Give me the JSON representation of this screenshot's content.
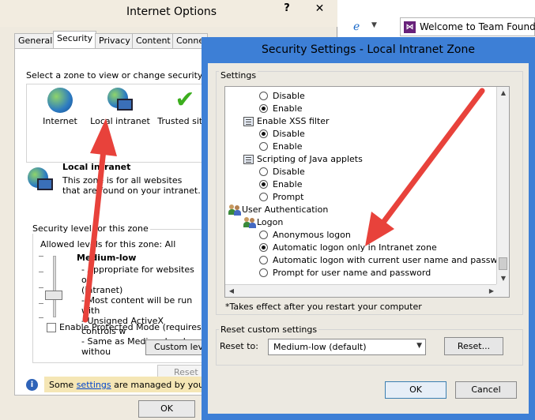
{
  "internet_options": {
    "title": "Internet Options",
    "help": "?",
    "close": "✕",
    "tabs": [
      "General",
      "Security",
      "Privacy",
      "Content",
      "Conne"
    ],
    "zone_prompt": "Select a zone to view or change security setti",
    "zones": [
      {
        "label": "Internet",
        "icon": "globe-icon"
      },
      {
        "label": "Local intranet",
        "icon": "intranet-icon"
      },
      {
        "label": "Trusted sites",
        "icon": "checkmark-icon"
      }
    ],
    "zone_name": "Local intranet",
    "zone_desc": "This zone is for all websites that are found on your intranet.",
    "security_level_legend": "Security level for this zone",
    "allowed_levels": "Allowed levels for this zone: All",
    "level_name": "Medium-low",
    "level_desc_lines": [
      "- Appropriate for websites on",
      "(intranet)",
      "- Most content will be run with",
      "- Unsigned ActiveX controls w",
      "- Same as Medium level withou"
    ],
    "protected_mode_label": "Enable Protected Mode (requires rest",
    "custom_level_button": "Custom level",
    "reset_button": "Reset",
    "info_prefix": "Some ",
    "info_link": "settings",
    "info_suffix": " are managed by your sy",
    "ok_button": "OK"
  },
  "browser": {
    "tab_title": "Welcome to Team Foundat",
    "tab_icon": "visual-studio-icon"
  },
  "security_settings": {
    "title": "Security Settings - Local Intranet Zone",
    "settings_legend": "Settings",
    "tree": [
      {
        "kind": "radio",
        "label": "Disable",
        "selected": false,
        "indent": 1
      },
      {
        "kind": "radio",
        "label": "Enable",
        "selected": true,
        "indent": 1
      },
      {
        "kind": "category",
        "label": "Enable XSS filter",
        "indent": 0
      },
      {
        "kind": "radio",
        "label": "Disable",
        "selected": true,
        "indent": 1
      },
      {
        "kind": "radio",
        "label": "Enable",
        "selected": false,
        "indent": 1
      },
      {
        "kind": "category",
        "label": "Scripting of Java applets",
        "indent": 0
      },
      {
        "kind": "radio",
        "label": "Disable",
        "selected": false,
        "indent": 1
      },
      {
        "kind": "radio",
        "label": "Enable",
        "selected": true,
        "indent": 1
      },
      {
        "kind": "radio",
        "label": "Prompt",
        "selected": false,
        "indent": 1
      },
      {
        "kind": "group",
        "label": "User Authentication",
        "indent": -1
      },
      {
        "kind": "group",
        "label": "Logon",
        "indent": 0
      },
      {
        "kind": "radio",
        "label": "Anonymous logon",
        "selected": false,
        "indent": 1
      },
      {
        "kind": "radio",
        "label": "Automatic logon only in Intranet zone",
        "selected": true,
        "indent": 1
      },
      {
        "kind": "radio",
        "label": "Automatic logon with current user name and password",
        "selected": false,
        "indent": 1
      },
      {
        "kind": "radio",
        "label": "Prompt for user name and password",
        "selected": false,
        "indent": 1
      }
    ],
    "takes_effect": "*Takes effect after you restart your computer",
    "reset_legend": "Reset custom settings",
    "reset_to_label": "Reset to:",
    "reset_to_value": "Medium-low (default)",
    "reset_button": "Reset...",
    "ok_button": "OK",
    "cancel_button": "Cancel"
  },
  "colors": {
    "title_bar_active": "#3d7fd6",
    "annotation_arrow": "#e8423b"
  }
}
